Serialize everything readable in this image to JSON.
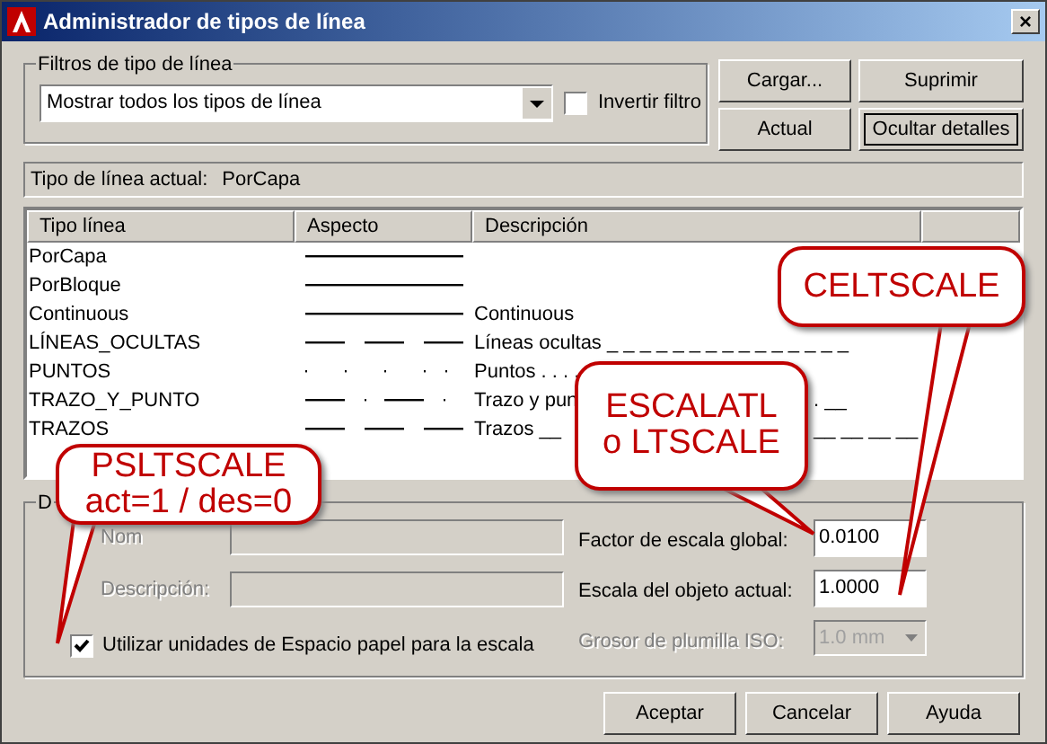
{
  "window": {
    "title": "Administrador de tipos de línea",
    "close": "×"
  },
  "filters": {
    "label": "Filtros de tipo de línea",
    "value": "Mostrar todos los tipos de línea",
    "invert": {
      "label": "Invertir filtro",
      "checked": false
    }
  },
  "buttons_top": [
    {
      "label": "Cargar...",
      "focused": false
    },
    {
      "label": "Suprimir",
      "focused": false
    },
    {
      "label": "Actual",
      "focused": false
    },
    {
      "label": "Ocultar detalles",
      "focused": true
    }
  ],
  "current": {
    "label": "Tipo de línea actual:",
    "value": "PorCapa"
  },
  "table": {
    "columns": [
      "Tipo línea",
      "Aspecto",
      "Descripción"
    ],
    "rows": [
      {
        "name": "PorCapa",
        "kind": "continuous"
      },
      {
        "name": "PorBloque",
        "kind": "continuous"
      },
      {
        "name": "Continuous",
        "kind": "continuous",
        "description": "Continuous"
      },
      {
        "name": "LÍNEAS_OCULTAS",
        "kind": "hidden",
        "description": "Líneas ocultas _ _ _ _ _ _ _ _ _ _ _ _ _ _ _"
      },
      {
        "name": "PUNTOS",
        "kind": "dots",
        "description": "Puntos . . . ."
      },
      {
        "name": "TRAZO_Y_PUNTO",
        "kind": "dashdot",
        "description": "Trazo y pun",
        "tail": ". __"
      },
      {
        "name": "TRAZOS",
        "kind": "dashed",
        "description": "Trazos __",
        "tail": "__ __ __ __"
      }
    ]
  },
  "details": {
    "label": "D",
    "name_label": "Nom",
    "description_label": "Descripción:",
    "paper_space": {
      "label": "Utilizar unidades de Espacio papel para la escala",
      "checked": true
    },
    "global_scale": {
      "label": "Factor de escala global:",
      "value": "0.0100"
    },
    "object_scale": {
      "label": "Escala del objeto actual:",
      "value": "1.0000"
    },
    "pen_width": {
      "label": "Grosor de plumilla ISO:",
      "value": "1.0 mm",
      "disabled": true
    }
  },
  "buttons_bottom": [
    "Aceptar",
    "Cancelar",
    "Ayuda"
  ],
  "callouts": [
    {
      "kind": "celtscale",
      "lines": [
        "CELTSCALE"
      ]
    },
    {
      "kind": "escalatl",
      "lines": [
        "ESCALATL",
        "o LTSCALE"
      ]
    },
    {
      "kind": "psltscale",
      "lines": [
        "PSLTSCALE",
        "act=1 / des=0"
      ]
    }
  ]
}
